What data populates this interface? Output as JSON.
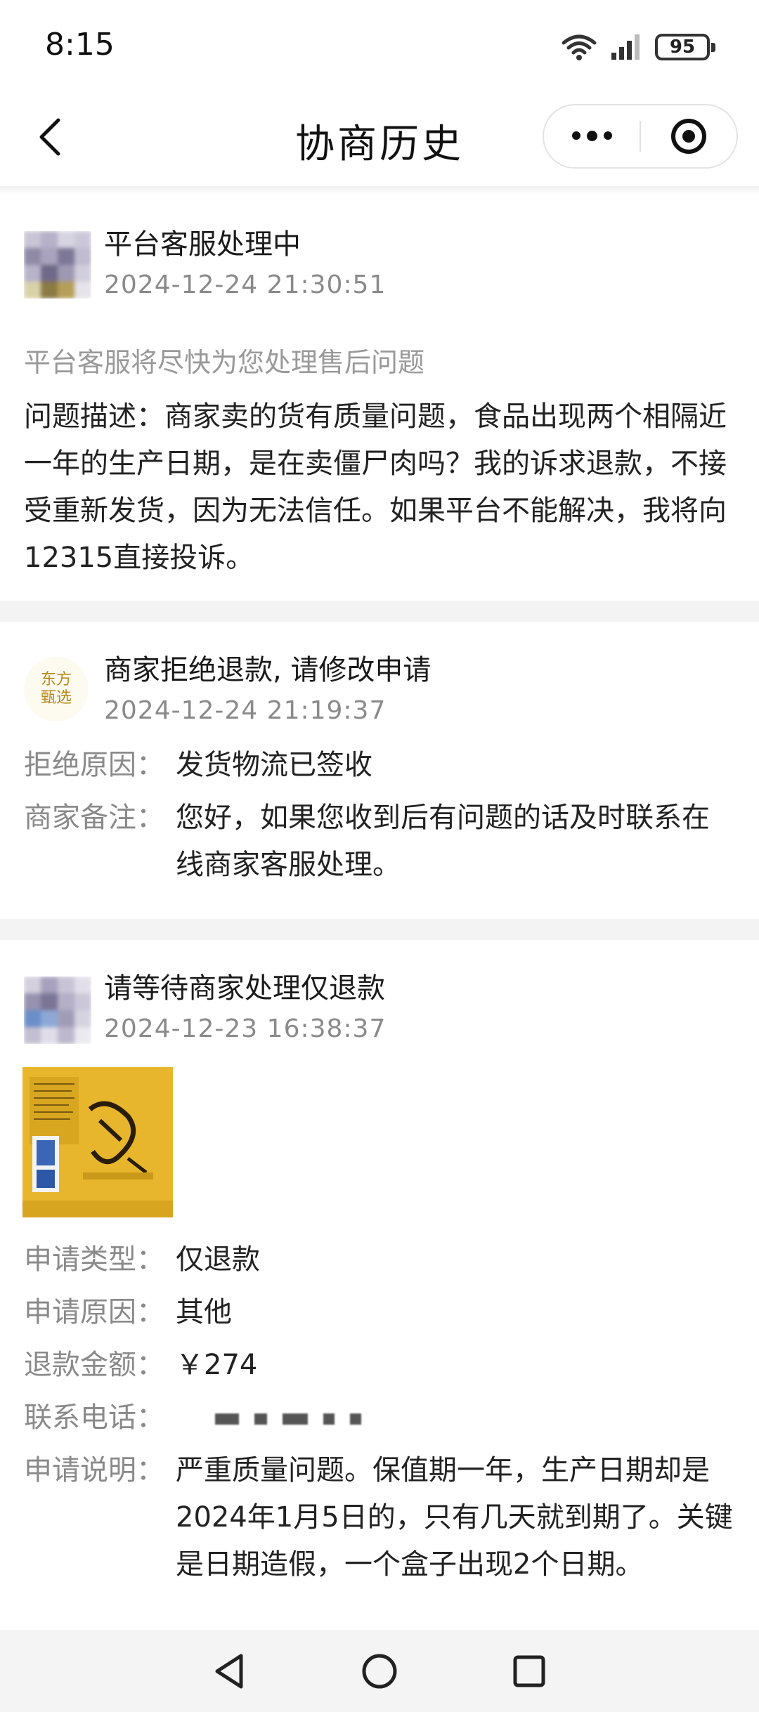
{
  "status_bar": {
    "time": "8:15",
    "battery": "95"
  },
  "nav": {
    "title": "协商历史"
  },
  "records": [
    {
      "title": "平台客服处理中",
      "time": "2024-12-24 21:30:51",
      "note": "平台客服将尽快为您处理售后问题",
      "description": "问题描述：商家卖的货有质量问题，食品出现两个相隔近一年的生产日期，是在卖僵尸肉吗？我的诉求退款，不接受重新发货，因为无法信任。如果平台不能解决，我将向12315直接投诉。"
    },
    {
      "title": "商家拒绝退款, 请修改申请",
      "time": "2024-12-24 21:19:37",
      "logo_text": "东方甄选",
      "fields": [
        {
          "label": "拒绝原因：",
          "value": "发货物流已签收"
        },
        {
          "label": "商家备注：",
          "value": "您好，如果您收到后有问题的话及时联系在线商家客服处理。"
        }
      ]
    },
    {
      "title": "请等待商家处理仅退款",
      "time": "2024-12-23 16:38:37",
      "fields": [
        {
          "label": "申请类型：",
          "value": "仅退款"
        },
        {
          "label": "申请原因：",
          "value": "其他"
        },
        {
          "label": "退款金额：",
          "value": "￥274"
        },
        {
          "label": "联系电话：",
          "value": ""
        },
        {
          "label": "申请说明：",
          "value": "严重质量问题。保值期一年，生产日期却是2024年1月5日的，只有几天就到期了。关键是日期造假，一个盒子出现2个日期。"
        }
      ]
    }
  ],
  "icons": [
    "chevron-left-icon",
    "more-icon",
    "target-icon",
    "triangle-back-icon",
    "circle-home-icon",
    "square-recent-icon",
    "wifi-icon",
    "signal-icon"
  ],
  "colors": {
    "accent_gold": "#e9b92e",
    "divider": "#f3f3f3",
    "muted_text": "#8a8a8a"
  }
}
